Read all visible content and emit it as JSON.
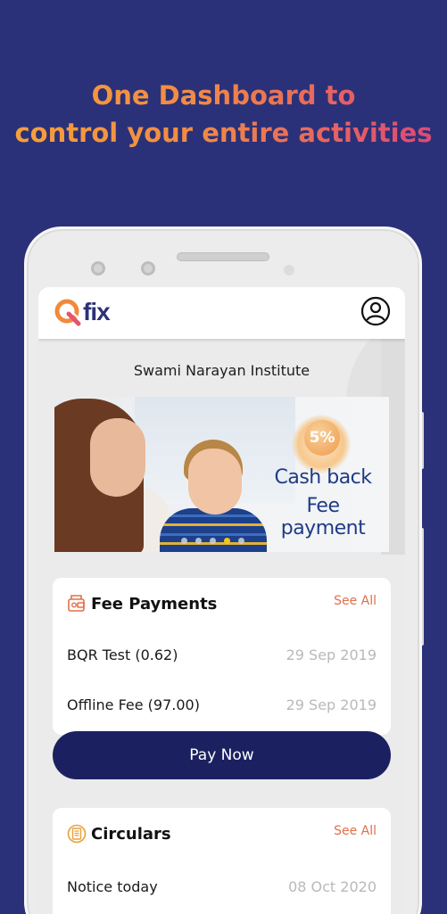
{
  "headline": {
    "line1": "One Dashboard to",
    "line2": "control your entire activities"
  },
  "app": {
    "logo_text": "fix",
    "institute_name": "Swami Narayan Institute"
  },
  "banner": {
    "badge": "5%",
    "line1": "Cash back",
    "line2": "Fee payment",
    "dot_count": 5,
    "active_dot_index": 3
  },
  "fee_payments": {
    "title": "Fee Payments",
    "see_all": "See All",
    "items": [
      {
        "name": "BQR Test (0.62)",
        "date": "29 Sep 2019"
      },
      {
        "name": "Offline Fee (97.00)",
        "date": "29 Sep 2019"
      }
    ],
    "pay_now": "Pay Now"
  },
  "circulars": {
    "title": "Circulars",
    "see_all": "See All",
    "items": [
      {
        "name": "Notice today",
        "date": "08 Oct 2020"
      }
    ]
  },
  "icons": {
    "profile": "account-circle-icon",
    "fee": "wallet-icon",
    "circulars": "document-coin-icon"
  },
  "colors": {
    "background": "#2b3178",
    "accent_orange": "#e0704a",
    "brand_navy": "#1b2160",
    "dot_active": "#f5c518"
  }
}
